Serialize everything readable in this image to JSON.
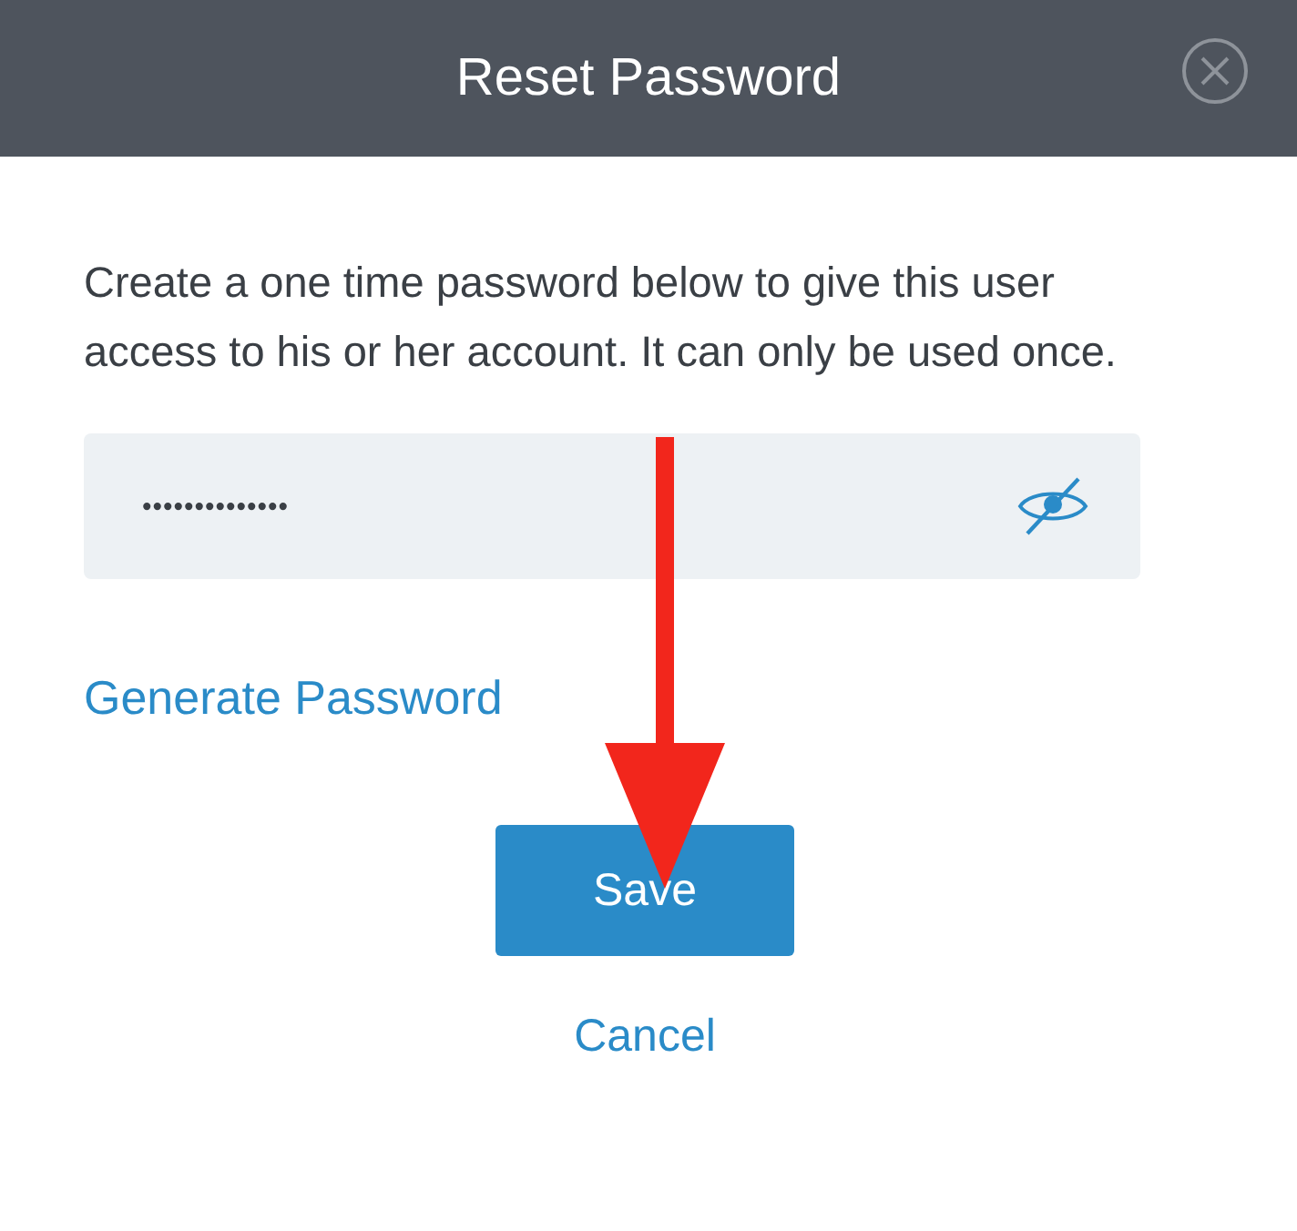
{
  "dialog": {
    "title": "Reset Password",
    "description": "Create a one time password below to give this user access to his or her account. It can only be used once.",
    "password_field": {
      "value": "••••••••••••••",
      "visible": false
    },
    "generate_link": "Generate Password",
    "save_button": "Save",
    "cancel_link": "Cancel"
  }
}
